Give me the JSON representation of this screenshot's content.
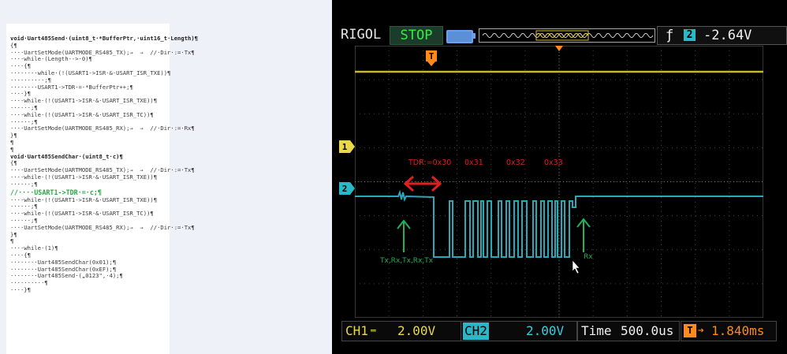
{
  "code": {
    "lines": [
      {
        "t": "void·Uart485Send·(uint8_t·*BufferPtr,·uint16_t·Length)¶",
        "style": "bold"
      },
      {
        "t": "{¶"
      },
      {
        "t": "····UartSetMode(UARTMODE_RS485_TX);→  →  //·Dir·:=·Tx¶"
      },
      {
        "t": "····while·(Length-->·0)¶"
      },
      {
        "t": "····{¶"
      },
      {
        "t": "········while·(!(USART1->ISR·&·USART_ISR_TXE))¶"
      },
      {
        "t": "··········;¶"
      },
      {
        "t": "········USART1->TDR·=·*BufferPtr++;¶"
      },
      {
        "t": "····}¶"
      },
      {
        "t": "····while·(!(USART1->ISR·&·USART_ISR_TXE))¶"
      },
      {
        "t": "······;¶"
      },
      {
        "t": "····while·(!(USART1->ISR·&·USART_ISR_TC))¶"
      },
      {
        "t": "······;¶"
      },
      {
        "t": "····UartSetMode(UARTMODE_RS485_RX);→  →  //·Dir·:=·Rx¶"
      },
      {
        "t": "}¶"
      },
      {
        "t": "¶"
      },
      {
        "t": "¶"
      },
      {
        "t": "void·Uart485SendChar·(uint8_t·c)¶",
        "style": "bold"
      },
      {
        "t": "{¶"
      },
      {
        "t": "····UartSetMode(UARTMODE_RS485_TX);→  →  //·Dir·:=·Tx¶"
      },
      {
        "t": "····while·(!(USART1->ISR·&·USART_ISR_TXE))¶"
      },
      {
        "t": "······;¶"
      },
      {
        "t": "//····USART1->TDR·=·c;¶",
        "style": "hl"
      },
      {
        "t": "····while·(!(USART1->ISR·&·USART_ISR_TXE))¶"
      },
      {
        "t": "······;¶"
      },
      {
        "t": "····while·(!(USART1->ISR·&·USART_ISR_TC))¶"
      },
      {
        "t": "······;¶"
      },
      {
        "t": "····UartSetMode(UARTMODE_RS485_RX);→  →  //·Dir·:=·Tx¶"
      },
      {
        "t": "}¶"
      },
      {
        "t": "¶"
      },
      {
        "t": "····while·(1)¶"
      },
      {
        "t": "····{¶"
      },
      {
        "t": "········Uart485SendChar(0x01);¶"
      },
      {
        "t": "········Uart485SendChar(0xEF);¶"
      },
      {
        "t": "········Uart485Send·(„0123\",·4);¶"
      },
      {
        "t": "··········¶"
      },
      {
        "t": "····}¶"
      }
    ]
  },
  "scope": {
    "brand": "RIGOL",
    "state": "STOP",
    "trigger_channel": "2",
    "trigger_level": "-2.64V",
    "trigger_edge": "ƒ",
    "trigger_marker": "T",
    "ch1_marker": "1",
    "ch2_marker": "2",
    "ch1_label": "CH1",
    "ch1_scale": "2.00V",
    "ch2_label": "CH2",
    "ch2_scale": "2.00V",
    "time_label": "Time",
    "time_scale": "500.0us",
    "offset_icon": "T",
    "offset_value": "1.840ms",
    "colors": {
      "ch1": "#e8d84a",
      "ch2": "#29b8c8",
      "trigger": "#ff8a1a",
      "annotation_red": "#e02020",
      "annotation_green": "#22b05a"
    },
    "annotations": {
      "tdr": "TDR:=0x30",
      "b1": "0x31",
      "b2": "0x32",
      "b3": "0x33",
      "tx_label": "Tx,Rx,Tx,Rx,Tx",
      "rx_label": "Rx"
    }
  }
}
